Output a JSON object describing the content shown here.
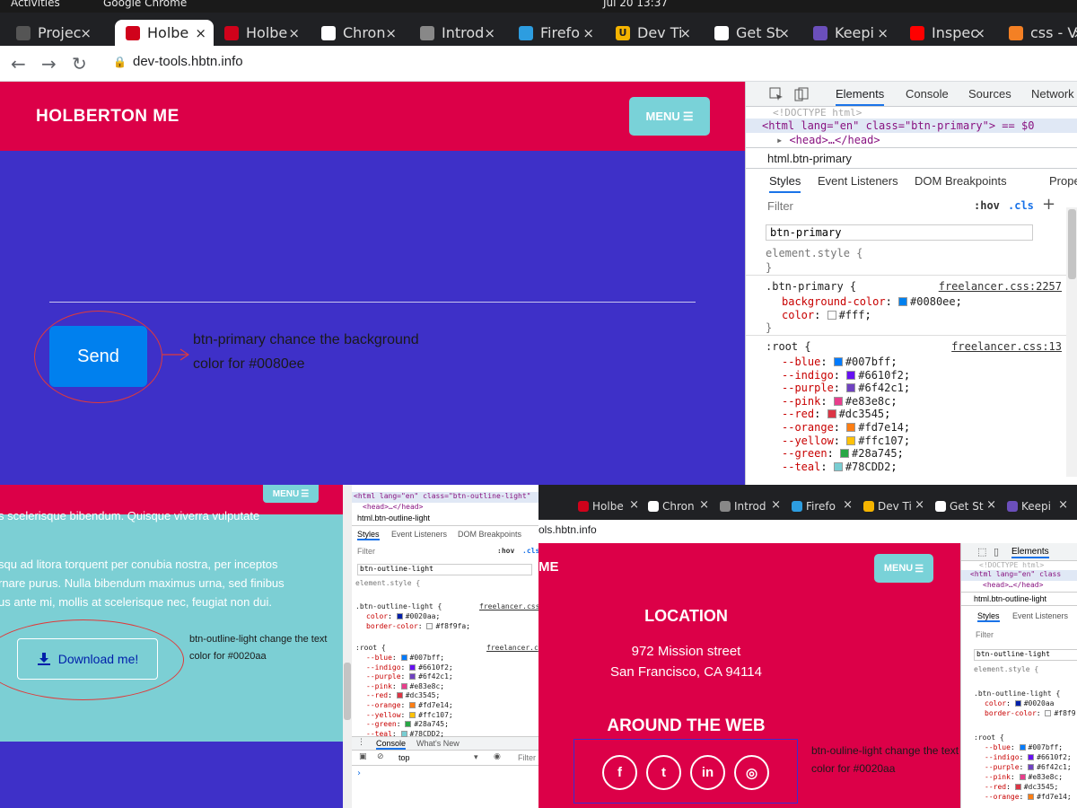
{
  "system_bar": {
    "activities": "Activities",
    "app": "Google Chrome",
    "clock": "Jul 20  13:37"
  },
  "browser_tabs": [
    {
      "label": "Projec",
      "fav": "",
      "color": "#202124"
    },
    {
      "label": "Holbe",
      "fav": "",
      "color": "#202124"
    },
    {
      "label": "Holbe",
      "fav": "",
      "color": "#202124"
    },
    {
      "label": "Chron",
      "fav": "",
      "color": "#202124"
    },
    {
      "label": "Introd",
      "fav": "",
      "color": "#202124"
    },
    {
      "label": "Firefo",
      "fav": "",
      "color": "#202124"
    },
    {
      "label": "Dev Ti",
      "fav": "U",
      "color": "#202124"
    },
    {
      "label": "Get St",
      "fav": "",
      "color": "#202124"
    },
    {
      "label": "Keepi",
      "fav": "",
      "color": "#202124"
    },
    {
      "label": "Inspec",
      "fav": "",
      "color": "#202124"
    },
    {
      "label": "css - V",
      "fav": "",
      "color": "#202124"
    }
  ],
  "tab_close": "×",
  "address": {
    "url": "dev-tools.hbtn.info"
  },
  "page1": {
    "brand": "HOLBERTON ME",
    "menu": "MENU",
    "send_button": "Send",
    "note_line1": "btn-primary chance the background",
    "note_line2": "color for #0080ee"
  },
  "devtools1": {
    "tabs": [
      "Elements",
      "Console",
      "Sources",
      "Network"
    ],
    "doctype": "<!DOCTYPE html>",
    "html_line": "<html lang=\"en\" class=\"btn-primary\"> == $0",
    "head_line": "<head>…</head>",
    "breadcrumb": "html.btn-primary",
    "subtabs": [
      "Styles",
      "Event Listeners",
      "DOM Breakpoints",
      "Properties"
    ],
    "filter_placeholder": "Filter",
    "hov": ":hov",
    "cls": ".cls",
    "search_value": "btn-primary",
    "element_style": "element.style {",
    "close_brace": "}",
    "rule1_selector": ".btn-primary {",
    "rule1_source": "freelancer.css:2257",
    "rule1_props": [
      {
        "name": "background-color",
        "value": "#0080ee",
        "color": "#0080ee"
      },
      {
        "name": "color",
        "value": "#fff",
        "color": "#ffffff"
      }
    ],
    "rule2_selector": ":root {",
    "rule2_source": "freelancer.css:13",
    "root_vars": [
      {
        "name": "--blue",
        "value": "#007bff",
        "color": "#007bff"
      },
      {
        "name": "--indigo",
        "value": "#6610f2",
        "color": "#6610f2"
      },
      {
        "name": "--purple",
        "value": "#6f42c1",
        "color": "#6f42c1"
      },
      {
        "name": "--pink",
        "value": "#e83e8c",
        "color": "#e83e8c"
      },
      {
        "name": "--red",
        "value": "#dc3545",
        "color": "#dc3545"
      },
      {
        "name": "--orange",
        "value": "#fd7e14",
        "color": "#fd7e14"
      },
      {
        "name": "--yellow",
        "value": "#ffc107",
        "color": "#ffc107"
      },
      {
        "name": "--green",
        "value": "#28a745",
        "color": "#28a745"
      },
      {
        "name": "--teal",
        "value": "#78CDD2",
        "color": "#78CDD2"
      }
    ]
  },
  "page2": {
    "menu": "MENU",
    "lines": [
      "s scelerisque bibendum. Quisque viverra vulputate",
      "squ ad litora torquent per conubia nostra, per inceptos",
      "rnare purus. Nulla bibendum maximus urna, sed finibus",
      "us ante mi, mollis at scelerisque nec, feugiat non dui."
    ],
    "download_button": "Download me!",
    "note": "btn-outline-light change the text color for #0020aa"
  },
  "devtools2": {
    "html_line": "<html lang=\"en\" class=\"btn-outline-light\"",
    "head_line": "<head>…</head>",
    "breadcrumb": "html.btn-outline-light",
    "subtabs": [
      "Styles",
      "Event Listeners",
      "DOM Breakpoints"
    ],
    "filter": "Filter",
    "hov": ":hov",
    "cls": ".cls",
    "search_value": "btn-outline-light",
    "element_style": "element.style {",
    "rule_selector": ".btn-outline-light {",
    "rule_source": "freelancer.css",
    "rule_props": [
      {
        "name": "color",
        "value": "#0020aa",
        "color": "#0020aa"
      },
      {
        "name": "border-color",
        "value": "#f8f9fa",
        "color": "#f8f9fa"
      }
    ],
    "root_selector": ":root {",
    "root_source": "freelancer.c",
    "drawer_tabs": [
      "Console",
      "What's New"
    ],
    "context": "top",
    "drawer_filter": "Filter"
  },
  "tabs3": [
    "Holbe",
    "Chron",
    "Introd",
    "Firefo",
    "Dev Ti",
    "Get St",
    "Keepi"
  ],
  "address3": "ols.hbtn.info",
  "page3": {
    "brand_fragment": "ME",
    "menu": "MENU",
    "location_title": "LOCATION",
    "address_line1": "972 Mission street",
    "address_line2": "San Francisco, CA 94114",
    "web_title": "AROUND THE WEB",
    "social": [
      "f",
      "t",
      "in",
      "◎"
    ],
    "note": "btn-ouline-light change the text color for #0020aa"
  },
  "devtools3": {
    "tab": "Elements",
    "doctype": "<!DOCTYPE html>",
    "html_line": "<html lang=\"en\" class",
    "head_line": "<head>…</head>",
    "breadcrumb": "html.btn-outline-light",
    "subtabs": [
      "Styles",
      "Event Listeners"
    ],
    "filter": "Filter",
    "search_value": "btn-outline-light",
    "element_style": "element.style {",
    "rule_selector": ".btn-outline-light {",
    "rule_props": [
      {
        "name": "color",
        "value": "#0020aa",
        "color": "#0020aa"
      },
      {
        "name": "border-color",
        "value": "#f8f9",
        "color": "#f8f9fa"
      }
    ],
    "root_selector": ":root {",
    "root_vars": [
      {
        "name": "--blue",
        "value": "#007bff",
        "color": "#007bff"
      },
      {
        "name": "--indigo",
        "value": "#6610f2",
        "color": "#6610f2"
      },
      {
        "name": "--purple",
        "value": "#6f42c1",
        "color": "#6f42c1"
      },
      {
        "name": "--pink",
        "value": "#e83e8c",
        "color": "#e83e8c"
      },
      {
        "name": "--red",
        "value": "#dc3545",
        "color": "#dc3545"
      },
      {
        "name": "--orange",
        "value": "#fd7e14",
        "color": "#fd7e14"
      }
    ]
  }
}
